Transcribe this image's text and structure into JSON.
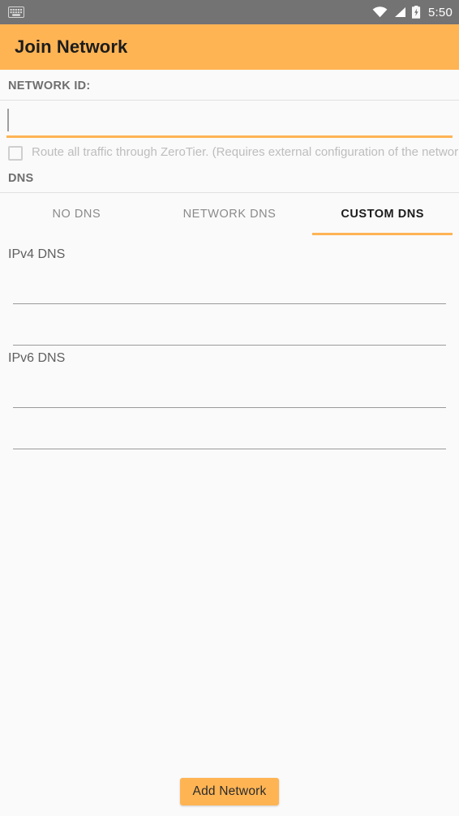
{
  "status_bar": {
    "keyboard_icon": "keyboard-icon",
    "wifi_icon": "wifi-icon",
    "signal_icon": "signal-icon",
    "battery_icon": "battery-charging-icon",
    "clock": "5:50",
    "background_color": "#737373",
    "foreground_color": "#ffffff"
  },
  "app_bar": {
    "title": "Join Network",
    "background_color": "#ffb454",
    "title_color": "#1c1c1c"
  },
  "network_id": {
    "section_label": "NETWORK ID:",
    "value": "",
    "placeholder": "",
    "focused": true,
    "underline_color": "#ffb454"
  },
  "route_all": {
    "label": "Route all traffic through ZeroTier. (Requires external configuration of the network)",
    "checked": false,
    "enabled": false
  },
  "dns": {
    "section_label": "DNS",
    "tabs": [
      {
        "label": "NO DNS",
        "active": false
      },
      {
        "label": "NETWORK DNS",
        "active": false
      },
      {
        "label": "CUSTOM DNS",
        "active": true
      }
    ],
    "groups": [
      {
        "label": "IPv4 DNS",
        "fields": [
          {
            "value": "",
            "placeholder": ""
          },
          {
            "value": "",
            "placeholder": ""
          }
        ]
      },
      {
        "label": "IPv6 DNS",
        "fields": [
          {
            "value": "",
            "placeholder": ""
          },
          {
            "value": "",
            "placeholder": ""
          }
        ]
      }
    ]
  },
  "footer": {
    "add_network_label": "Add Network",
    "button_color": "#ffb454"
  }
}
